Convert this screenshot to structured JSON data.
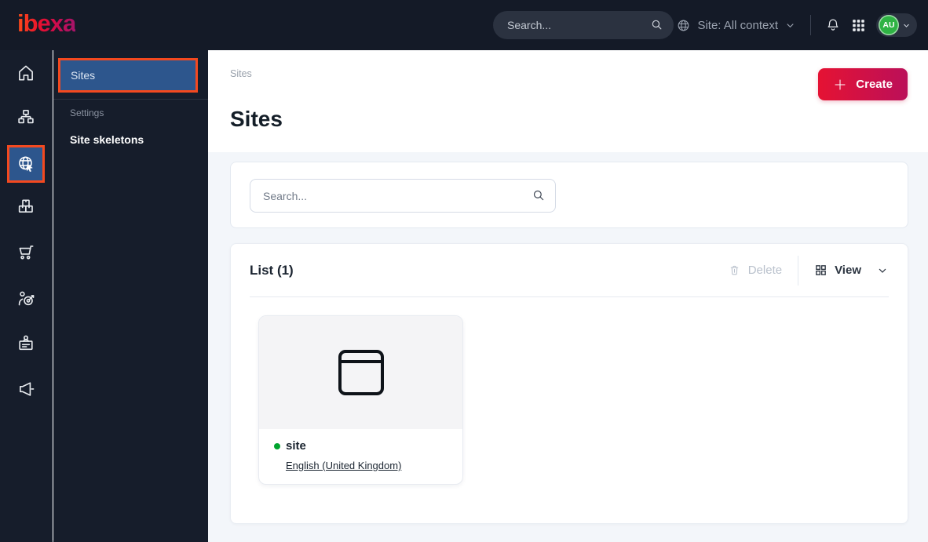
{
  "topbar": {
    "logo_text": "ibexa",
    "search_placeholder": "Search...",
    "site_context_label": "Site: All context",
    "avatar_initials": "AU"
  },
  "sidebar": {
    "rail_items": [
      {
        "name": "dashboard",
        "icon": "home-icon"
      },
      {
        "name": "content",
        "icon": "sitemap-icon"
      },
      {
        "name": "site-management",
        "icon": "globe-cursor-icon",
        "active": true
      },
      {
        "name": "product-catalog",
        "icon": "boxes-icon"
      },
      {
        "name": "commerce",
        "icon": "cart-icon"
      },
      {
        "name": "personalization",
        "icon": "person-target-icon"
      },
      {
        "name": "admin",
        "icon": "badge-icon"
      },
      {
        "name": "marketing",
        "icon": "megaphone-icon"
      }
    ],
    "menu": {
      "active_item_label": "Sites",
      "section_label": "Settings",
      "item_label": "Site skeletons"
    }
  },
  "main": {
    "breadcrumb": "Sites",
    "create_button_label": "Create",
    "page_title": "Sites",
    "search_placeholder": "Search...",
    "list": {
      "header": "List (1)",
      "delete_label": "Delete",
      "view_label": "View",
      "items": [
        {
          "name": "site",
          "language_link": "English (United Kingdom)"
        }
      ]
    }
  },
  "colors": {
    "topbar_bg": "#141a27",
    "sidebar_bg": "#161d2b",
    "active_blue": "#2d568d",
    "annotation_orange": "#f4491f",
    "accent_red_start": "#e51233",
    "accent_red_end": "#bb1059",
    "status_green": "#00a42e",
    "content_bg": "#f3f6fa"
  }
}
